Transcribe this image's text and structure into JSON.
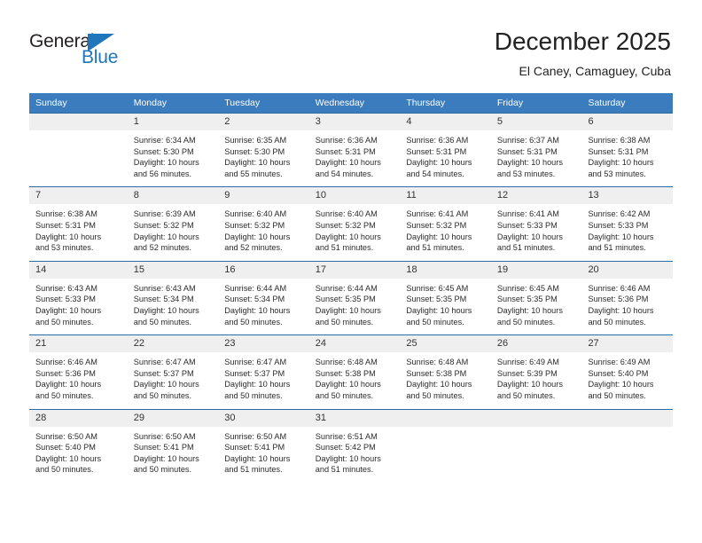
{
  "brand": {
    "name_part1": "General",
    "name_part2": "Blue",
    "accent_color": "#1f76bc"
  },
  "header": {
    "title": "December 2025",
    "subtitle": "El Caney, Camaguey, Cuba"
  },
  "calendar": {
    "header_color": "#3a7cbe",
    "weekday_headers": [
      "Sunday",
      "Monday",
      "Tuesday",
      "Wednesday",
      "Thursday",
      "Friday",
      "Saturday"
    ],
    "weeks": [
      [
        {
          "day": "",
          "lines": [
            "",
            "",
            "",
            ""
          ]
        },
        {
          "day": "1",
          "lines": [
            "Sunrise: 6:34 AM",
            "Sunset: 5:30 PM",
            "Daylight: 10 hours",
            "and 56 minutes."
          ]
        },
        {
          "day": "2",
          "lines": [
            "Sunrise: 6:35 AM",
            "Sunset: 5:30 PM",
            "Daylight: 10 hours",
            "and 55 minutes."
          ]
        },
        {
          "day": "3",
          "lines": [
            "Sunrise: 6:36 AM",
            "Sunset: 5:31 PM",
            "Daylight: 10 hours",
            "and 54 minutes."
          ]
        },
        {
          "day": "4",
          "lines": [
            "Sunrise: 6:36 AM",
            "Sunset: 5:31 PM",
            "Daylight: 10 hours",
            "and 54 minutes."
          ]
        },
        {
          "day": "5",
          "lines": [
            "Sunrise: 6:37 AM",
            "Sunset: 5:31 PM",
            "Daylight: 10 hours",
            "and 53 minutes."
          ]
        },
        {
          "day": "6",
          "lines": [
            "Sunrise: 6:38 AM",
            "Sunset: 5:31 PM",
            "Daylight: 10 hours",
            "and 53 minutes."
          ]
        }
      ],
      [
        {
          "day": "7",
          "lines": [
            "Sunrise: 6:38 AM",
            "Sunset: 5:31 PM",
            "Daylight: 10 hours",
            "and 53 minutes."
          ]
        },
        {
          "day": "8",
          "lines": [
            "Sunrise: 6:39 AM",
            "Sunset: 5:32 PM",
            "Daylight: 10 hours",
            "and 52 minutes."
          ]
        },
        {
          "day": "9",
          "lines": [
            "Sunrise: 6:40 AM",
            "Sunset: 5:32 PM",
            "Daylight: 10 hours",
            "and 52 minutes."
          ]
        },
        {
          "day": "10",
          "lines": [
            "Sunrise: 6:40 AM",
            "Sunset: 5:32 PM",
            "Daylight: 10 hours",
            "and 51 minutes."
          ]
        },
        {
          "day": "11",
          "lines": [
            "Sunrise: 6:41 AM",
            "Sunset: 5:32 PM",
            "Daylight: 10 hours",
            "and 51 minutes."
          ]
        },
        {
          "day": "12",
          "lines": [
            "Sunrise: 6:41 AM",
            "Sunset: 5:33 PM",
            "Daylight: 10 hours",
            "and 51 minutes."
          ]
        },
        {
          "day": "13",
          "lines": [
            "Sunrise: 6:42 AM",
            "Sunset: 5:33 PM",
            "Daylight: 10 hours",
            "and 51 minutes."
          ]
        }
      ],
      [
        {
          "day": "14",
          "lines": [
            "Sunrise: 6:43 AM",
            "Sunset: 5:33 PM",
            "Daylight: 10 hours",
            "and 50 minutes."
          ]
        },
        {
          "day": "15",
          "lines": [
            "Sunrise: 6:43 AM",
            "Sunset: 5:34 PM",
            "Daylight: 10 hours",
            "and 50 minutes."
          ]
        },
        {
          "day": "16",
          "lines": [
            "Sunrise: 6:44 AM",
            "Sunset: 5:34 PM",
            "Daylight: 10 hours",
            "and 50 minutes."
          ]
        },
        {
          "day": "17",
          "lines": [
            "Sunrise: 6:44 AM",
            "Sunset: 5:35 PM",
            "Daylight: 10 hours",
            "and 50 minutes."
          ]
        },
        {
          "day": "18",
          "lines": [
            "Sunrise: 6:45 AM",
            "Sunset: 5:35 PM",
            "Daylight: 10 hours",
            "and 50 minutes."
          ]
        },
        {
          "day": "19",
          "lines": [
            "Sunrise: 6:45 AM",
            "Sunset: 5:35 PM",
            "Daylight: 10 hours",
            "and 50 minutes."
          ]
        },
        {
          "day": "20",
          "lines": [
            "Sunrise: 6:46 AM",
            "Sunset: 5:36 PM",
            "Daylight: 10 hours",
            "and 50 minutes."
          ]
        }
      ],
      [
        {
          "day": "21",
          "lines": [
            "Sunrise: 6:46 AM",
            "Sunset: 5:36 PM",
            "Daylight: 10 hours",
            "and 50 minutes."
          ]
        },
        {
          "day": "22",
          "lines": [
            "Sunrise: 6:47 AM",
            "Sunset: 5:37 PM",
            "Daylight: 10 hours",
            "and 50 minutes."
          ]
        },
        {
          "day": "23",
          "lines": [
            "Sunrise: 6:47 AM",
            "Sunset: 5:37 PM",
            "Daylight: 10 hours",
            "and 50 minutes."
          ]
        },
        {
          "day": "24",
          "lines": [
            "Sunrise: 6:48 AM",
            "Sunset: 5:38 PM",
            "Daylight: 10 hours",
            "and 50 minutes."
          ]
        },
        {
          "day": "25",
          "lines": [
            "Sunrise: 6:48 AM",
            "Sunset: 5:38 PM",
            "Daylight: 10 hours",
            "and 50 minutes."
          ]
        },
        {
          "day": "26",
          "lines": [
            "Sunrise: 6:49 AM",
            "Sunset: 5:39 PM",
            "Daylight: 10 hours",
            "and 50 minutes."
          ]
        },
        {
          "day": "27",
          "lines": [
            "Sunrise: 6:49 AM",
            "Sunset: 5:40 PM",
            "Daylight: 10 hours",
            "and 50 minutes."
          ]
        }
      ],
      [
        {
          "day": "28",
          "lines": [
            "Sunrise: 6:50 AM",
            "Sunset: 5:40 PM",
            "Daylight: 10 hours",
            "and 50 minutes."
          ]
        },
        {
          "day": "29",
          "lines": [
            "Sunrise: 6:50 AM",
            "Sunset: 5:41 PM",
            "Daylight: 10 hours",
            "and 50 minutes."
          ]
        },
        {
          "day": "30",
          "lines": [
            "Sunrise: 6:50 AM",
            "Sunset: 5:41 PM",
            "Daylight: 10 hours",
            "and 51 minutes."
          ]
        },
        {
          "day": "31",
          "lines": [
            "Sunrise: 6:51 AM",
            "Sunset: 5:42 PM",
            "Daylight: 10 hours",
            "and 51 minutes."
          ]
        },
        {
          "day": "",
          "lines": [
            "",
            "",
            "",
            ""
          ]
        },
        {
          "day": "",
          "lines": [
            "",
            "",
            "",
            ""
          ]
        },
        {
          "day": "",
          "lines": [
            "",
            "",
            "",
            ""
          ]
        }
      ]
    ]
  }
}
